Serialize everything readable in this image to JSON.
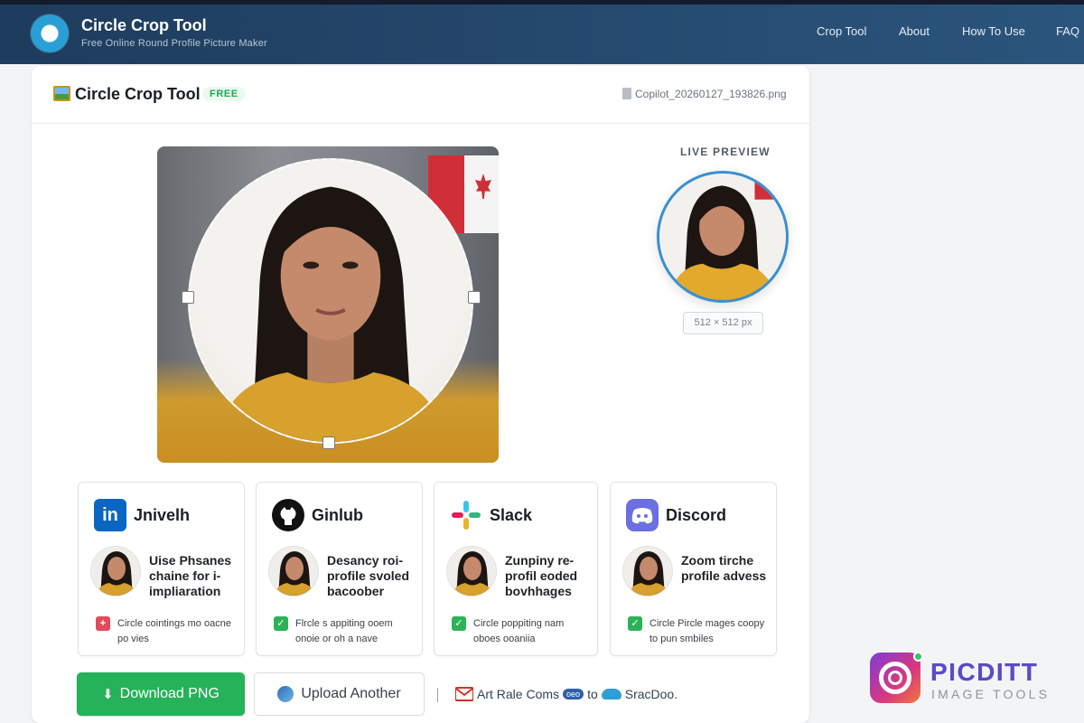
{
  "header": {
    "title": "Circle Crop Tool",
    "subtitle": "Free Online Round Profile Picture Maker",
    "nav": [
      "Crop Tool",
      "About",
      "How To Use",
      "FAQ"
    ]
  },
  "card": {
    "title": "Circle Crop Tool",
    "badge": "FREE",
    "file_name": "Copilot_20260127_193826.png"
  },
  "preview": {
    "label": "LIVE PREVIEW",
    "size": "512 × 512 px"
  },
  "platforms": [
    {
      "name": "Jnivelh",
      "desc": "Uise Phsanes chaine for i-impliaration",
      "note": "Circle cointings mo oacne po vies",
      "logo_color": "#0a66c2",
      "check_color": "#e04c5c",
      "icon": "linkedin-icon"
    },
    {
      "name": "Ginlub",
      "desc": "Desancy roi-profile svoled bacoober",
      "note": "Flrcle s appiting ooem onoie or oh a nave",
      "logo_color": "#111111",
      "check_color": "#2cb358",
      "icon": "github-icon"
    },
    {
      "name": "Slack",
      "desc": "Zunpiny re-profil eoded bovhhages",
      "note": "Circle poppiting nam oboes ooaniia",
      "logo_color": "#ffffff",
      "check_color": "#2cb358",
      "icon": "slack-icon"
    },
    {
      "name": "Discord",
      "desc": "Zoom tirche profile advess",
      "note": "Circle Pircle mages coopy to pun smbiles",
      "logo_color": "#5865f2",
      "check_color": "#2cb358",
      "icon": "discord-icon"
    }
  ],
  "actions": {
    "download": "Download PNG",
    "upload": "Upload Another",
    "promo_a": "Art Rale Coms",
    "promo_pill": "oeo",
    "promo_b": "to",
    "promo_c": "SracDoo."
  },
  "watermark": {
    "name": "PICDITT",
    "sub": "IMAGE TOOLS"
  },
  "colors": {
    "header_bg": "#24476b",
    "accent_blue": "#3b8fd1",
    "download_green": "#25b258",
    "badge_green": "#1fa84f"
  }
}
